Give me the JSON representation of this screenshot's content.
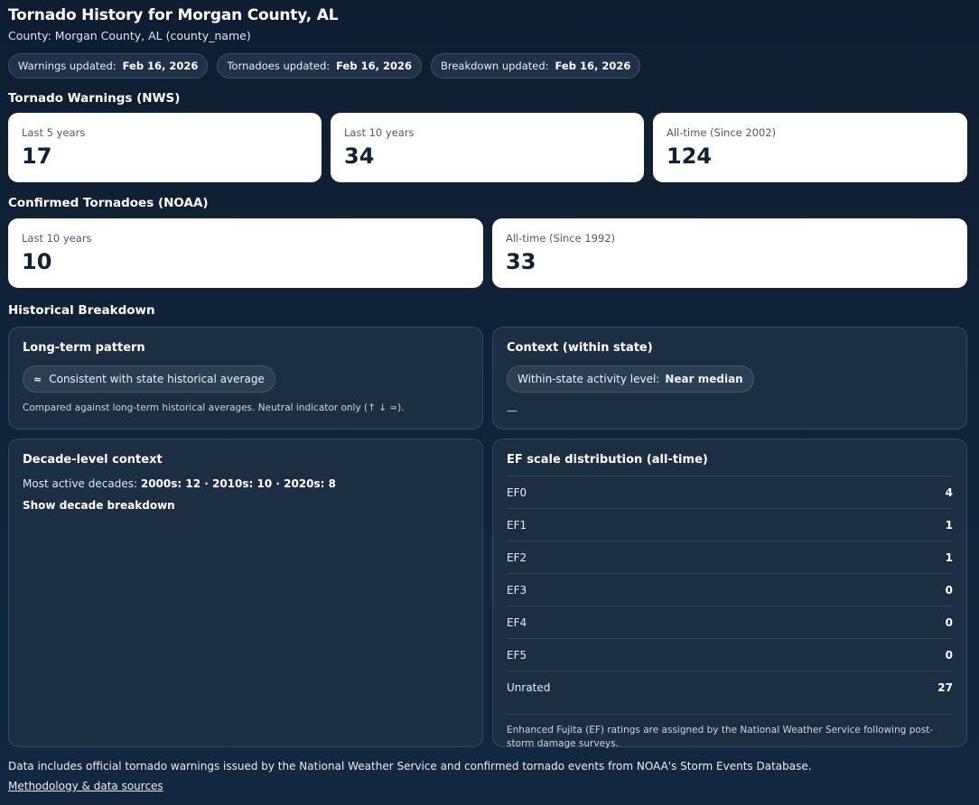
{
  "header": {
    "title": "Tornado History for Morgan County, AL",
    "subtitle": "County: Morgan County, AL (county_name)"
  },
  "badges": [
    {
      "label": "Warnings updated:",
      "value": "Feb 16, 2026"
    },
    {
      "label": "Tornadoes updated:",
      "value": "Feb 16, 2026"
    },
    {
      "label": "Breakdown updated:",
      "value": "Feb 16, 2026"
    }
  ],
  "warnings": {
    "heading": "Tornado Warnings (NWS)",
    "cards": [
      {
        "label": "Last 5 years",
        "value": "17"
      },
      {
        "label": "Last 10 years",
        "value": "34"
      },
      {
        "label": "All-time (Since 2002)",
        "value": "124"
      }
    ]
  },
  "confirmed": {
    "heading": "Confirmed Tornadoes (NOAA)",
    "cards": [
      {
        "label": "Last 10 years",
        "value": "10"
      },
      {
        "label": "All-time (Since 1992)",
        "value": "33"
      }
    ]
  },
  "breakdown": {
    "heading": "Historical Breakdown",
    "long_term": {
      "title": "Long-term pattern",
      "pill_icon": "≈",
      "pill_text": "Consistent with state historical average",
      "note": "Compared against long-term historical averages. Neutral indicator only (↑ ↓ ≈)."
    },
    "context": {
      "title": "Context (within state)",
      "pill_label": "Within-state activity level:",
      "pill_value": "Near median",
      "dash": "—"
    },
    "decade": {
      "title": "Decade-level context",
      "prefix": "Most active decades:",
      "value": "2000s: 12 · 2010s: 10 · 2020s: 8",
      "link": "Show decade breakdown"
    },
    "ef": {
      "title": "EF scale distribution (all-time)",
      "rows": [
        {
          "label": "EF0",
          "value": "4"
        },
        {
          "label": "EF1",
          "value": "1"
        },
        {
          "label": "EF2",
          "value": "1"
        },
        {
          "label": "EF3",
          "value": "0"
        },
        {
          "label": "EF4",
          "value": "0"
        },
        {
          "label": "EF5",
          "value": "0"
        },
        {
          "label": "Unrated",
          "value": "27"
        }
      ],
      "note": "Enhanced Fujita (EF) ratings are assigned by the National Weather Service following post-storm damage surveys."
    }
  },
  "footer": {
    "text": "Data includes official tornado warnings issued by the National Weather Service and confirmed tornado events from NOAA's Storm Events Database.",
    "link": "Methodology & data sources"
  }
}
